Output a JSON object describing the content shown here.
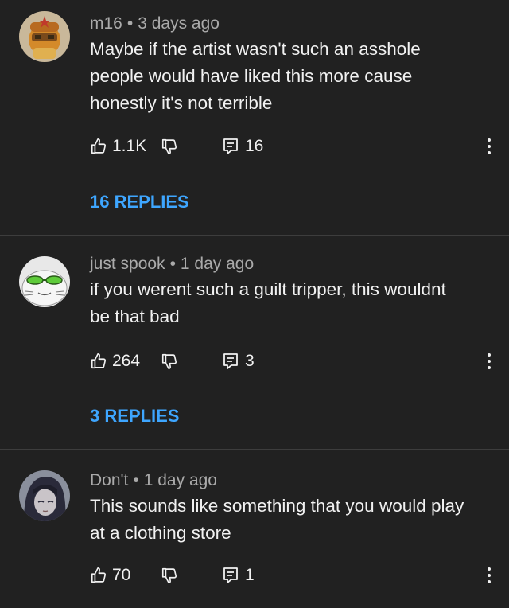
{
  "comments": [
    {
      "author": "m16",
      "time": "3 days ago",
      "lines": [
        "Maybe if the artist wasn't such an asshole",
        "people would have liked this more cause",
        "honestly it's not terrible"
      ],
      "likes": "1.1K",
      "reply_count": "16",
      "replies_label": "16 REPLIES"
    },
    {
      "author": "just spook",
      "time": "1 day ago",
      "lines": [
        "if you werent such a guilt tripper, this wouldnt",
        "be that bad"
      ],
      "likes": "264",
      "reply_count": "3",
      "replies_label": "3 REPLIES"
    },
    {
      "author": "Don't",
      "time": "1 day ago",
      "lines": [
        "This sounds like something that you would play",
        "at a clothing store"
      ],
      "likes": "70",
      "reply_count": "1"
    }
  ],
  "meta_separator": "•",
  "colors": {
    "background": "#212121",
    "link": "#3ea6ff",
    "meta": "#aaaaaa",
    "text": "#f1f1f1"
  },
  "icons": {
    "like": "thumbs-up-icon",
    "dislike": "thumbs-down-icon",
    "reply": "reply-icon",
    "menu": "more-vertical-icon"
  }
}
